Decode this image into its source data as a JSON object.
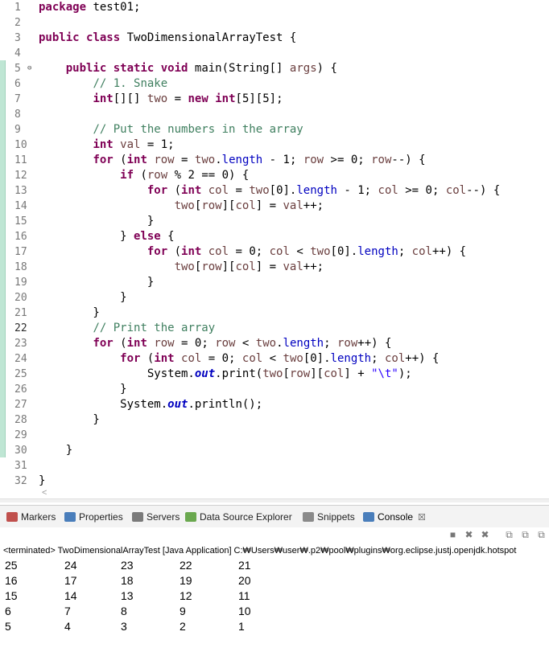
{
  "editor": {
    "lines": [
      {
        "n": "1",
        "code": "<span class=\"kw\">package</span> test01;"
      },
      {
        "n": "2",
        "code": ""
      },
      {
        "n": "3",
        "code": "<span class=\"kw\">public</span> <span class=\"kw\">class</span> TwoDimensionalArrayTest {"
      },
      {
        "n": "4",
        "code": ""
      },
      {
        "n": "5",
        "fold": "⊖",
        "code": "    <span class=\"kw\">public</span> <span class=\"kw\">static</span> <span class=\"kw\">void</span> main(String[] <span class=\"vr\">args</span>) {"
      },
      {
        "n": "6",
        "code": "        <span class=\"cm\">// 1. Snake</span>"
      },
      {
        "n": "7",
        "code": "        <span class=\"kw\">int</span>[][] <span class=\"vr\">two</span> = <span class=\"kw\">new</span> <span class=\"kw\">int</span>[5][5];"
      },
      {
        "n": "8",
        "code": ""
      },
      {
        "n": "9",
        "code": "        <span class=\"cm\">// Put the numbers in the array</span>"
      },
      {
        "n": "10",
        "code": "        <span class=\"kw\">int</span> <span class=\"vr\">val</span> = 1;"
      },
      {
        "n": "11",
        "code": "        <span class=\"kw\">for</span> (<span class=\"kw\">int</span> <span class=\"vr\">row</span> = <span class=\"vr\">two</span>.<span class=\"fd\">length</span> - 1; <span class=\"vr\">row</span> >= 0; <span class=\"vr\">row</span>--) {"
      },
      {
        "n": "12",
        "code": "            <span class=\"kw\">if</span> (<span class=\"vr\">row</span> % 2 == 0) {"
      },
      {
        "n": "13",
        "code": "                <span class=\"kw\">for</span> (<span class=\"kw\">int</span> <span class=\"vr\">col</span> = <span class=\"vr\">two</span>[0].<span class=\"fd\">length</span> - 1; <span class=\"vr\">col</span> >= 0; <span class=\"vr\">col</span>--) {"
      },
      {
        "n": "14",
        "code": "                    <span class=\"vr\">two</span>[<span class=\"vr\">row</span>][<span class=\"vr\">col</span>] = <span class=\"vr\">val</span>++;"
      },
      {
        "n": "15",
        "code": "                }"
      },
      {
        "n": "16",
        "code": "            } <span class=\"kw\">else</span> {"
      },
      {
        "n": "17",
        "code": "                <span class=\"kw\">for</span> (<span class=\"kw\">int</span> <span class=\"vr\">col</span> = 0; <span class=\"vr\">col</span> < <span class=\"vr\">two</span>[0].<span class=\"fd\">length</span>; <span class=\"vr\">col</span>++) {"
      },
      {
        "n": "18",
        "code": "                    <span class=\"vr\">two</span>[<span class=\"vr\">row</span>][<span class=\"vr\">col</span>] = <span class=\"vr\">val</span>++;"
      },
      {
        "n": "19",
        "code": "                }"
      },
      {
        "n": "20",
        "code": "            }"
      },
      {
        "n": "21",
        "code": "        }"
      },
      {
        "n": "22",
        "code": "        <span class=\"cm\">// Print the array</span>"
      },
      {
        "n": "23",
        "code": "        <span class=\"kw\">for</span> (<span class=\"kw\">int</span> <span class=\"vr\">row</span> = 0; <span class=\"vr\">row</span> < <span class=\"vr\">two</span>.<span class=\"fd\">length</span>; <span class=\"vr\">row</span>++) {"
      },
      {
        "n": "24",
        "code": "            <span class=\"kw\">for</span> (<span class=\"kw\">int</span> <span class=\"vr\">col</span> = 0; <span class=\"vr\">col</span> < <span class=\"vr\">two</span>[0].<span class=\"fd\">length</span>; <span class=\"vr\">col</span>++) {"
      },
      {
        "n": "25",
        "code": "                System.<span class=\"sf\">out</span>.print(<span class=\"vr\">two</span>[<span class=\"vr\">row</span>][<span class=\"vr\">col</span>] + <span class=\"st\">\"\\t\"</span>);"
      },
      {
        "n": "26",
        "code": "            }"
      },
      {
        "n": "27",
        "code": "            System.<span class=\"sf\">out</span>.println();"
      },
      {
        "n": "28",
        "code": "        }"
      },
      {
        "n": "29",
        "code": ""
      },
      {
        "n": "30",
        "code": "    }"
      },
      {
        "n": "31",
        "code": ""
      },
      {
        "n": "32",
        "code": "}"
      }
    ],
    "scroll_hint": "<"
  },
  "views": {
    "tabs": [
      {
        "label": "Markers",
        "icon": "markers-icon",
        "color": "#c0504d"
      },
      {
        "label": "Properties",
        "icon": "properties-icon",
        "color": "#4a7ebb"
      },
      {
        "label": "Servers",
        "icon": "servers-icon",
        "color": "#7a7a7a"
      },
      {
        "label": "Data Source Explorer",
        "icon": "data-source-icon",
        "color": "#6aa84f"
      },
      {
        "label": "Snippets",
        "icon": "snippets-icon",
        "color": "#8a8a8a"
      },
      {
        "label": "Console",
        "icon": "console-icon",
        "color": "#4a7ebb",
        "close": "☒"
      }
    ]
  },
  "console": {
    "status": "<terminated> TwoDimensionalArrayTest [Java Application] C:₩Users₩user₩.p2₩pool₩plugins₩org.eclipse.justj.openjdk.hotspot",
    "toolbar": [
      "■",
      "✖",
      "✖",
      "⧉",
      "⧉",
      "⧉"
    ],
    "output": [
      [
        "25",
        "24",
        "23",
        "22",
        "21"
      ],
      [
        "16",
        "17",
        "18",
        "19",
        "20"
      ],
      [
        "15",
        "14",
        "13",
        "12",
        "11"
      ],
      [
        "6",
        "7",
        "8",
        "9",
        "10"
      ],
      [
        "5",
        "4",
        "3",
        "2",
        "1"
      ]
    ]
  }
}
